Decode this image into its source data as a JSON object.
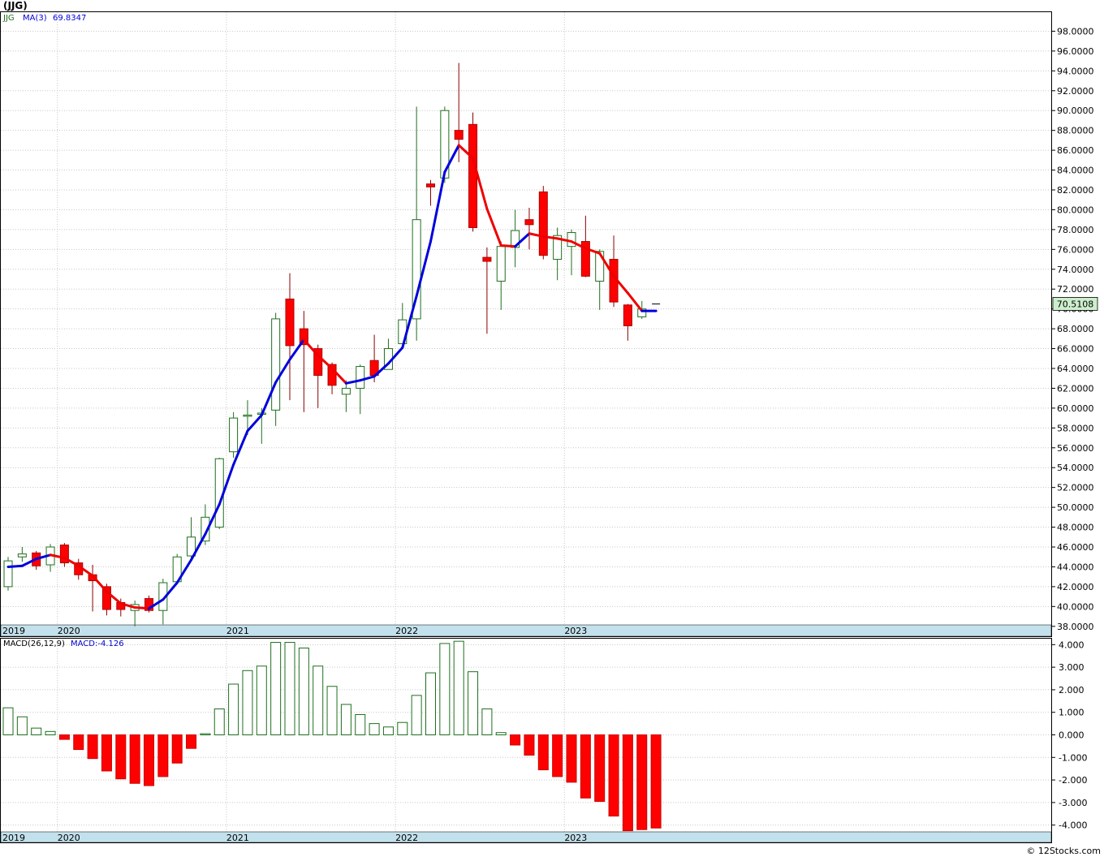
{
  "title": "(JJG)",
  "footer": "© 12Stocks.com",
  "colors": {
    "up_candle": "#1f6f1f",
    "down_candle": "#ff0000",
    "ma_up": "#0000dd",
    "ma_down": "#ee0000",
    "macd_pos": "#1f6f1f",
    "macd_neg": "#ff0000",
    "axis_band": "#c3e1ec",
    "grid": "#c8c8c8",
    "last_price_bg": "#cdeecd"
  },
  "chart_data": [
    {
      "type": "candlestick",
      "title": "",
      "legend": {
        "symbol": "JJG",
        "ma_label": "MA(3)",
        "ma_value": "69.8347"
      },
      "last_price_label": "70.5108",
      "ylim": [
        37.0,
        100.0
      ],
      "y_ticks": [
        "38.0000",
        "40.0000",
        "42.0000",
        "44.0000",
        "46.0000",
        "48.0000",
        "50.0000",
        "52.0000",
        "54.0000",
        "56.0000",
        "58.0000",
        "60.0000",
        "62.0000",
        "64.0000",
        "66.0000",
        "68.0000",
        "70.0000",
        "72.0000",
        "74.0000",
        "76.0000",
        "78.0000",
        "80.0000",
        "82.0000",
        "84.0000",
        "86.0000",
        "88.0000",
        "90.0000",
        "92.0000",
        "94.0000",
        "96.0000",
        "98.0000"
      ],
      "year_labels": [
        {
          "label": "2019",
          "index": -0.5
        },
        {
          "label": "2020",
          "index": 3.5
        },
        {
          "label": "2021",
          "index": 15.5
        },
        {
          "label": "2022",
          "index": 27.5
        },
        {
          "label": "2023",
          "index": 39.5
        }
      ],
      "candles": [
        [
          42.0,
          44.6,
          41.6,
          45.0
        ],
        [
          45.0,
          45.3,
          44.5,
          46.0
        ],
        [
          45.4,
          44.1,
          43.7,
          45.6
        ],
        [
          44.2,
          46.0,
          43.5,
          46.3
        ],
        [
          46.2,
          44.4,
          44.0,
          46.4
        ],
        [
          44.4,
          43.2,
          42.7,
          44.8
        ],
        [
          43.2,
          42.6,
          39.5,
          44.2
        ],
        [
          42.0,
          39.7,
          39.1,
          42.3
        ],
        [
          40.4,
          39.7,
          39.0,
          40.8
        ],
        [
          39.6,
          40.2,
          38.0,
          40.6
        ],
        [
          40.8,
          39.6,
          39.4,
          41.1
        ],
        [
          39.6,
          42.4,
          38.2,
          42.8
        ],
        [
          42.5,
          45.0,
          42.2,
          45.3
        ],
        [
          45.1,
          47.0,
          44.8,
          49.0
        ],
        [
          46.6,
          49.0,
          46.2,
          50.3
        ],
        [
          48.0,
          54.9,
          47.8,
          55.0
        ],
        [
          55.6,
          59.0,
          55.0,
          59.6
        ],
        [
          59.2,
          59.3,
          57.3,
          60.8
        ],
        [
          59.5,
          59.5,
          56.4,
          60.0
        ],
        [
          59.8,
          69.0,
          58.2,
          69.6
        ],
        [
          71.0,
          66.3,
          60.8,
          73.6
        ],
        [
          68.0,
          66.4,
          59.6,
          69.8
        ],
        [
          66.0,
          63.3,
          60.0,
          66.4
        ],
        [
          64.4,
          62.3,
          61.4,
          64.6
        ],
        [
          61.4,
          62.0,
          59.6,
          62.8
        ],
        [
          62.0,
          64.2,
          59.4,
          64.4
        ],
        [
          64.8,
          63.3,
          62.6,
          67.4
        ],
        [
          63.9,
          66.0,
          63.9,
          67.0
        ],
        [
          66.5,
          68.9,
          66.5,
          70.6
        ],
        [
          69.0,
          79.0,
          66.8,
          90.4
        ],
        [
          82.6,
          82.3,
          80.4,
          83.0
        ],
        [
          83.2,
          90.0,
          82.7,
          90.4
        ],
        [
          88.0,
          87.1,
          84.8,
          94.8
        ],
        [
          88.6,
          78.2,
          77.8,
          89.8
        ],
        [
          75.2,
          74.8,
          67.5,
          76.2
        ],
        [
          72.8,
          76.3,
          69.9,
          76.8
        ],
        [
          76.2,
          77.9,
          74.2,
          80.0
        ],
        [
          79.0,
          78.5,
          76.0,
          80.2
        ],
        [
          81.8,
          75.4,
          75.0,
          82.4
        ],
        [
          75.0,
          77.4,
          72.9,
          78.2
        ],
        [
          76.3,
          77.7,
          73.4,
          78.0
        ],
        [
          76.8,
          73.3,
          73.2,
          79.4
        ],
        [
          72.8,
          75.8,
          69.9,
          76.0
        ],
        [
          75.0,
          70.7,
          70.2,
          77.4
        ],
        [
          70.4,
          68.3,
          66.8,
          70.5
        ],
        [
          69.2,
          70.0,
          69.0,
          70.8
        ],
        [
          70.5,
          70.5,
          70.5,
          70.5
        ]
      ],
      "ma": [
        44.0,
        44.1,
        44.8,
        45.2,
        44.9,
        44.1,
        43.1,
        41.5,
        40.3,
        39.9,
        39.8,
        40.7,
        42.4,
        44.7,
        47.3,
        50.3,
        54.3,
        57.7,
        59.3,
        62.6,
        64.9,
        66.9,
        65.3,
        64.0,
        62.5,
        62.8,
        63.2,
        64.5,
        66.1,
        71.3,
        76.8,
        83.8,
        86.5,
        85.2,
        80.1,
        76.4,
        76.3,
        77.6,
        77.3,
        77.1,
        76.8,
        76.1,
        75.6,
        73.3,
        71.6,
        69.8,
        69.8
      ]
    },
    {
      "type": "bar",
      "title": "",
      "legend": {
        "label": "MACD(26,12,9)",
        "value_label": "MACD:-4.126"
      },
      "ylim": [
        -4.3,
        4.3
      ],
      "y_ticks": [
        "4.000",
        "3.000",
        "2.000",
        "1.000",
        "0.000",
        "-1.000",
        "-2.000",
        "-3.000",
        "-4.000"
      ],
      "year_labels": [
        {
          "label": "2019",
          "index": -0.5
        },
        {
          "label": "2020",
          "index": 3.5
        },
        {
          "label": "2021",
          "index": 15.5
        },
        {
          "label": "2022",
          "index": 27.5
        },
        {
          "label": "2023",
          "index": 39.5
        }
      ],
      "values": [
        1.2,
        0.8,
        0.3,
        0.15,
        -0.2,
        -0.65,
        -1.05,
        -1.6,
        -1.95,
        -2.15,
        -2.25,
        -1.85,
        -1.25,
        -0.6,
        0.05,
        1.15,
        2.25,
        2.85,
        3.05,
        4.1,
        4.1,
        3.85,
        3.05,
        2.15,
        1.35,
        0.9,
        0.5,
        0.35,
        0.55,
        1.75,
        2.75,
        4.05,
        4.15,
        2.8,
        1.15,
        0.1,
        -0.45,
        -0.9,
        -1.55,
        -1.85,
        -2.1,
        -2.8,
        -2.95,
        -3.6,
        -4.25,
        -4.2,
        -4.13
      ]
    }
  ]
}
